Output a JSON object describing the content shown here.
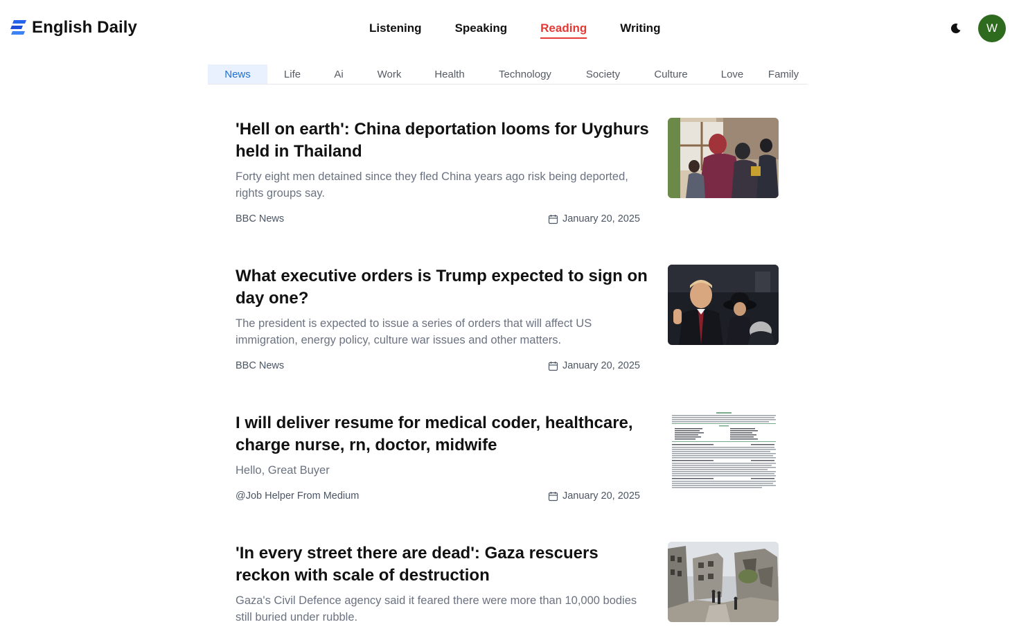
{
  "app": {
    "title": "English Daily",
    "logo_icon": "stacked-e-logo-icon",
    "accent_color": "#1f6fd1",
    "active_color": "#e53935"
  },
  "nav": {
    "items": [
      {
        "label": "Listening"
      },
      {
        "label": "Speaking"
      },
      {
        "label": "Reading",
        "active": true
      },
      {
        "label": "Writing"
      }
    ]
  },
  "header": {
    "theme_icon": "moon-icon",
    "avatar_initial": "W",
    "avatar_color": "#2e6b1f"
  },
  "tabs": [
    {
      "label": "News",
      "active": true
    },
    {
      "label": "Life"
    },
    {
      "label": "Ai"
    },
    {
      "label": "Work"
    },
    {
      "label": "Health"
    },
    {
      "label": "Technology"
    },
    {
      "label": "Society"
    },
    {
      "label": "Culture"
    },
    {
      "label": "Love"
    },
    {
      "label": "Family"
    }
  ],
  "articles": [
    {
      "title": "'Hell on earth': China deportation looms for Uyghurs held in Thailand",
      "description": "Forty eight men detained since they fled China years ago risk being deported, rights groups say.",
      "source": "BBC News",
      "date": "January 20, 2025",
      "image": "family-at-window-photo"
    },
    {
      "title": "What executive orders is Trump expected to sign on day one?",
      "description": "The president is expected to issue a series of orders that will affect US immigration, energy policy, culture war issues and other matters.",
      "source": "BBC News",
      "date": "January 20, 2025",
      "image": "inauguration-photo"
    },
    {
      "title": "I will deliver resume for medical coder, healthcare, charge nurse, rn, doctor, midwife",
      "description": "Hello, Great Buyer",
      "source": "@Job Helper From Medium",
      "date": "January 20, 2025",
      "image": "resume-document-thumbnail"
    },
    {
      "title": "'In every street there are dead': Gaza rescuers reckon with scale of destruction",
      "description": "Gaza's Civil Defence agency said it feared there were more than 10,000 bodies still buried under rubble.",
      "source": "",
      "date": "",
      "image": "destroyed-buildings-photo"
    }
  ]
}
